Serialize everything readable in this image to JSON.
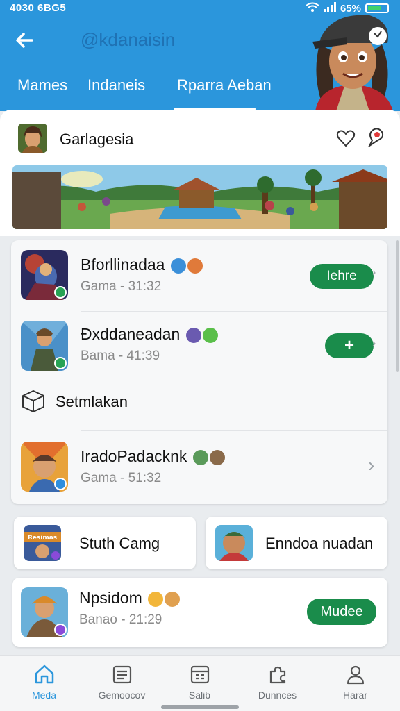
{
  "status_bar": {
    "time": "4030 6BG5",
    "battery": "65%"
  },
  "header": {
    "handle": "@kdanaisin",
    "tabs": [
      {
        "label": "Mames",
        "active": false
      },
      {
        "label": "Indaneis",
        "active": false
      },
      {
        "label": "Rparra Aeban",
        "active": true
      }
    ]
  },
  "group": {
    "title": "Garlagesia"
  },
  "games": [
    {
      "title": "Bforllinadaa",
      "subtitle": "Gama - 31:32",
      "action": "Iehre",
      "badge_color": "#27a354"
    },
    {
      "title": "Ðxddaneadan",
      "subtitle": "Bama - 41:39",
      "action": "+",
      "badge_color": "#27a354"
    },
    {
      "title": "IradoPadacknk",
      "subtitle": "Gama - 51:32",
      "action": "",
      "badge_color": "#2e8ede"
    }
  ],
  "section": {
    "title": "Setmlakan"
  },
  "cards": [
    {
      "label": "Stuth Camg",
      "thumb_label": "Resimas"
    },
    {
      "label": "Enndoa nuadan"
    }
  ],
  "featured": {
    "title": "Npsidom",
    "subtitle": "Banao - 21:29",
    "action": "Mudee"
  },
  "nav": [
    {
      "label": "Meda",
      "icon": "home-icon",
      "active": true
    },
    {
      "label": "Gemoocov",
      "icon": "news-icon",
      "active": false
    },
    {
      "label": "Salib",
      "icon": "calendar-icon",
      "active": false
    },
    {
      "label": "Dunnces",
      "icon": "puzzle-icon",
      "active": false
    },
    {
      "label": "Harar",
      "icon": "person-icon",
      "active": false
    }
  ],
  "colors": {
    "header": "#2b96dc",
    "accent_green": "#1a8c4b",
    "active_nav": "#2b96dc"
  }
}
